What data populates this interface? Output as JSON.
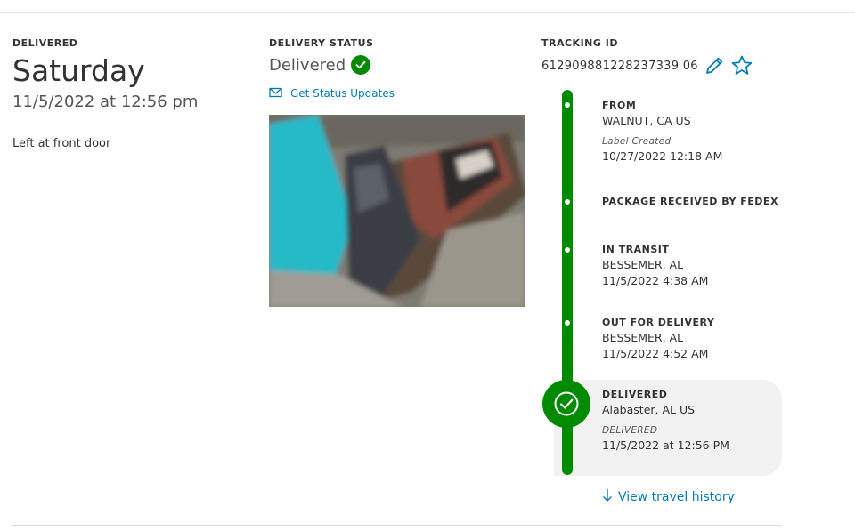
{
  "colors": {
    "green": "#008a00",
    "link_blue": "#007ab7",
    "panel_gray": "#f2f2f2"
  },
  "delivery": {
    "label": "DELIVERED",
    "weekday": "Saturday",
    "datetime": "11/5/2022 at 12:56 pm",
    "left_at": "Left at front door"
  },
  "status": {
    "label": "DELIVERY STATUS",
    "value": "Delivered",
    "value_icon": "check-circle-icon",
    "updates_icon": "envelope-icon",
    "updates_link": "Get Status Updates",
    "photo_icon": "proof-of-delivery-photo"
  },
  "tracking": {
    "label": "TRACKING ID",
    "number": "612909881228237339 06",
    "edit_icon": "pencil-icon",
    "favorite_icon": "star-icon"
  },
  "timeline": {
    "events": [
      {
        "title": "FROM",
        "location": "WALNUT, CA US",
        "note": "Label Created",
        "time": "10/27/2022 12:18 AM"
      },
      {
        "title": "PACKAGE RECEIVED BY FEDEX"
      },
      {
        "title": "IN TRANSIT",
        "location": "BESSEMER, AL",
        "time": "11/5/2022 4:38 AM"
      },
      {
        "title": "OUT FOR DELIVERY",
        "location": "BESSEMER, AL",
        "time": "11/5/2022 4:52 AM"
      },
      {
        "title": "DELIVERED",
        "location": "Alabaster, AL US",
        "note": "DELIVERED",
        "time": "11/5/2022 at 12:56 PM"
      }
    ],
    "history_icon": "arrow-down-icon",
    "history_link": "View travel history"
  }
}
